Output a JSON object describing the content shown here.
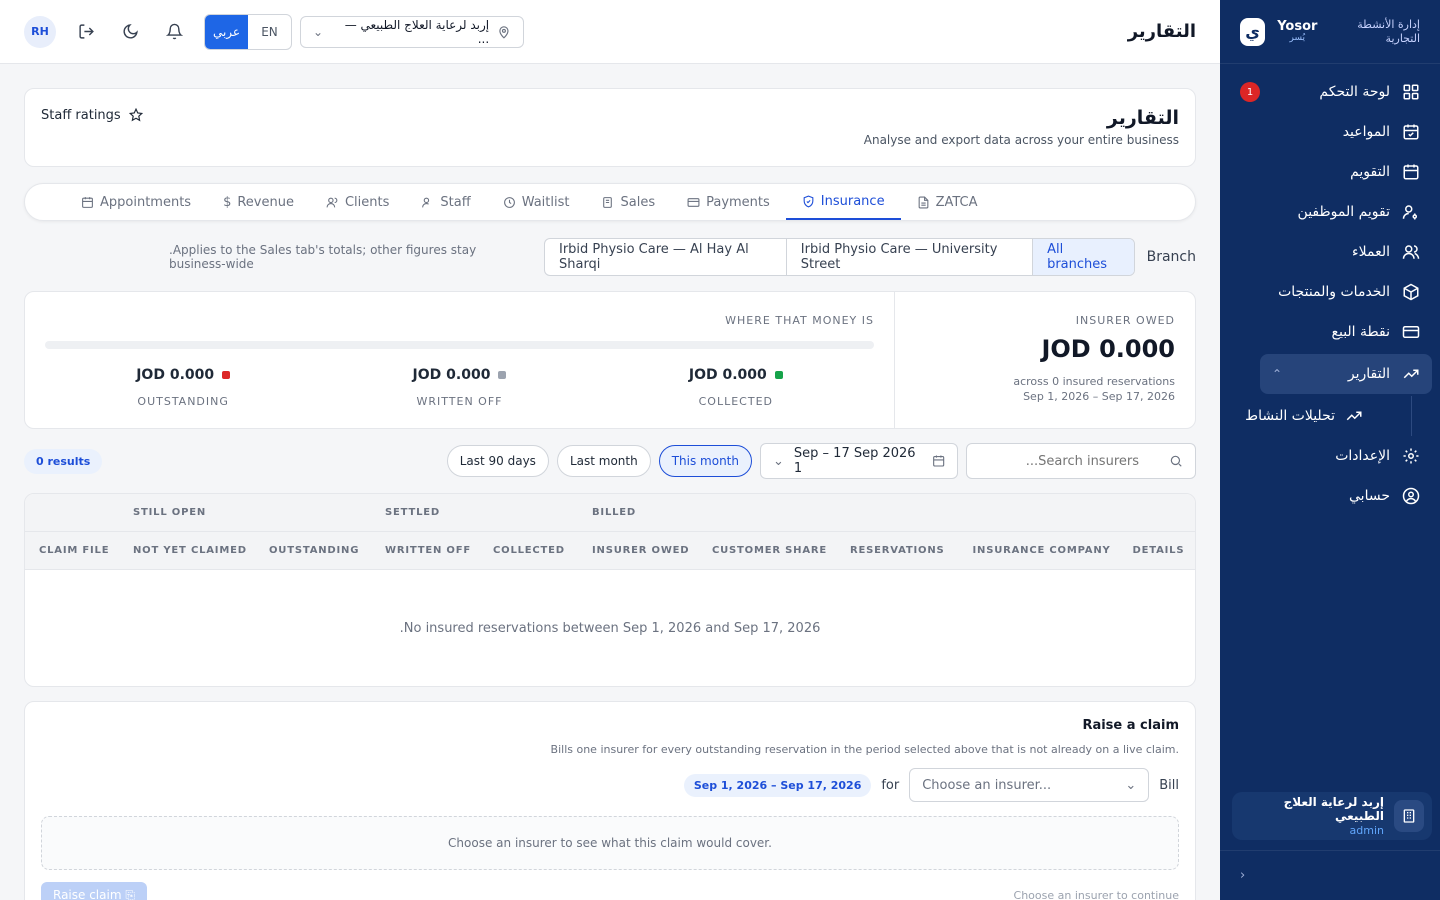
{
  "brand": {
    "name_en": "Yosor",
    "name_ar": "يُسر",
    "logo_glyph": "ي",
    "subtitle": "إدارة الأنشطة التجارية"
  },
  "topbar": {
    "page_title": "التقارير",
    "avatar_initials": "RH",
    "lang_ar": "عربي",
    "lang_en": "EN",
    "branch_selected": "إربد لرعاية العلاج الطبيعي — ..."
  },
  "sidebar": {
    "items": [
      {
        "label": "لوحة التحكم",
        "icon": "dashboard-icon",
        "badge": "1"
      },
      {
        "label": "المواعيد",
        "icon": "calendar-check-icon"
      },
      {
        "label": "التقويم",
        "icon": "calendar-icon"
      },
      {
        "label": "تقويم الموظفين",
        "icon": "user-cog-icon"
      },
      {
        "label": "العملاء",
        "icon": "users-icon"
      },
      {
        "label": "الخدمات والمنتجات",
        "icon": "box-icon"
      },
      {
        "label": "نقطة البيع",
        "icon": "credit-card-icon"
      },
      {
        "label": "التقارير",
        "icon": "trending-up-icon",
        "active": true
      },
      {
        "label": "تحليلات النشاط",
        "icon": "trending-up-icon",
        "sub": true
      },
      {
        "label": "الإعدادات",
        "icon": "gear-icon"
      },
      {
        "label": "حسابي",
        "icon": "user-circle-icon"
      }
    ],
    "org_name": "إربد لرعاية العلاج الطبيعي",
    "org_role": "admin"
  },
  "header": {
    "title": "التقارير",
    "subtitle": "Analyse and export data across your entire business",
    "staff_ratings": "Staff ratings"
  },
  "tabs": [
    {
      "label": "Appointments",
      "icon": "calendar-icon"
    },
    {
      "label": "Revenue",
      "icon": "dollar-icon"
    },
    {
      "label": "Clients",
      "icon": "users-icon"
    },
    {
      "label": "Staff",
      "icon": "user-icon"
    },
    {
      "label": "Waitlist",
      "icon": "clock-icon"
    },
    {
      "label": "Sales",
      "icon": "receipt-icon"
    },
    {
      "label": "Payments",
      "icon": "credit-card-icon"
    },
    {
      "label": "Insurance",
      "icon": "shield-icon",
      "active": true
    },
    {
      "label": "ZATCA",
      "icon": "file-icon"
    }
  ],
  "branch_filter": {
    "label": "Branch",
    "note": ".Applies to the Sales tab's totals; other figures stay business-wide",
    "options": [
      "Irbid Physio Care — Al Hay Al Sharqi",
      "Irbid Physio Care — University Street",
      "All branches"
    ],
    "selected": "All branches"
  },
  "summary": {
    "insurer_owed_label": "INSURER OWED",
    "insurer_owed_value": "JOD 0.000",
    "across_text": "across 0 insured reservations",
    "period_text": "Sep 1, 2026 – Sep 17, 2026",
    "where_label": "WHERE THAT MONEY IS",
    "progress_fraction": 0,
    "buckets": [
      {
        "value": "JOD 0.000",
        "label": "OUTSTANDING",
        "color": "#dc2626"
      },
      {
        "value": "JOD 0.000",
        "label": "WRITTEN OFF",
        "color": "#9ca3af"
      },
      {
        "value": "JOD 0.000",
        "label": "COLLECTED",
        "color": "#16a34a"
      }
    ]
  },
  "filters": {
    "results": "0 results",
    "chips": [
      "Last 90 days",
      "Last month",
      "This month"
    ],
    "active_chip": "This month",
    "date_range": "Sep – 17 Sep 2026 1",
    "search_placeholder": "...Search insurers"
  },
  "table": {
    "groups": {
      "still_open": "STILL OPEN",
      "settled": "SETTLED",
      "billed": "BILLED"
    },
    "columns": [
      "CLAIM FILE",
      "NOT YET CLAIMED",
      "OUTSTANDING",
      "WRITTEN OFF",
      "COLLECTED",
      "INSURER OWED",
      "CUSTOMER SHARE",
      "RESERVATIONS",
      "INSURANCE COMPANY",
      "DETAILS"
    ],
    "empty_text": ".No insured reservations between Sep 1, 2026 and Sep 17, 2026"
  },
  "claim": {
    "title": "Raise a claim",
    "description": "Bills one insurer for every outstanding reservation in the period selected above that is not already on a live claim.",
    "bill_label": "Bill",
    "insurer_placeholder": "Choose an insurer...",
    "for_label": "for",
    "period": "Sep 1, 2026 – Sep 17, 2026",
    "preview_text": "Choose an insurer to see what this claim would cover.",
    "button_label": "Raise claim",
    "hint": "Choose an insurer to continue"
  }
}
